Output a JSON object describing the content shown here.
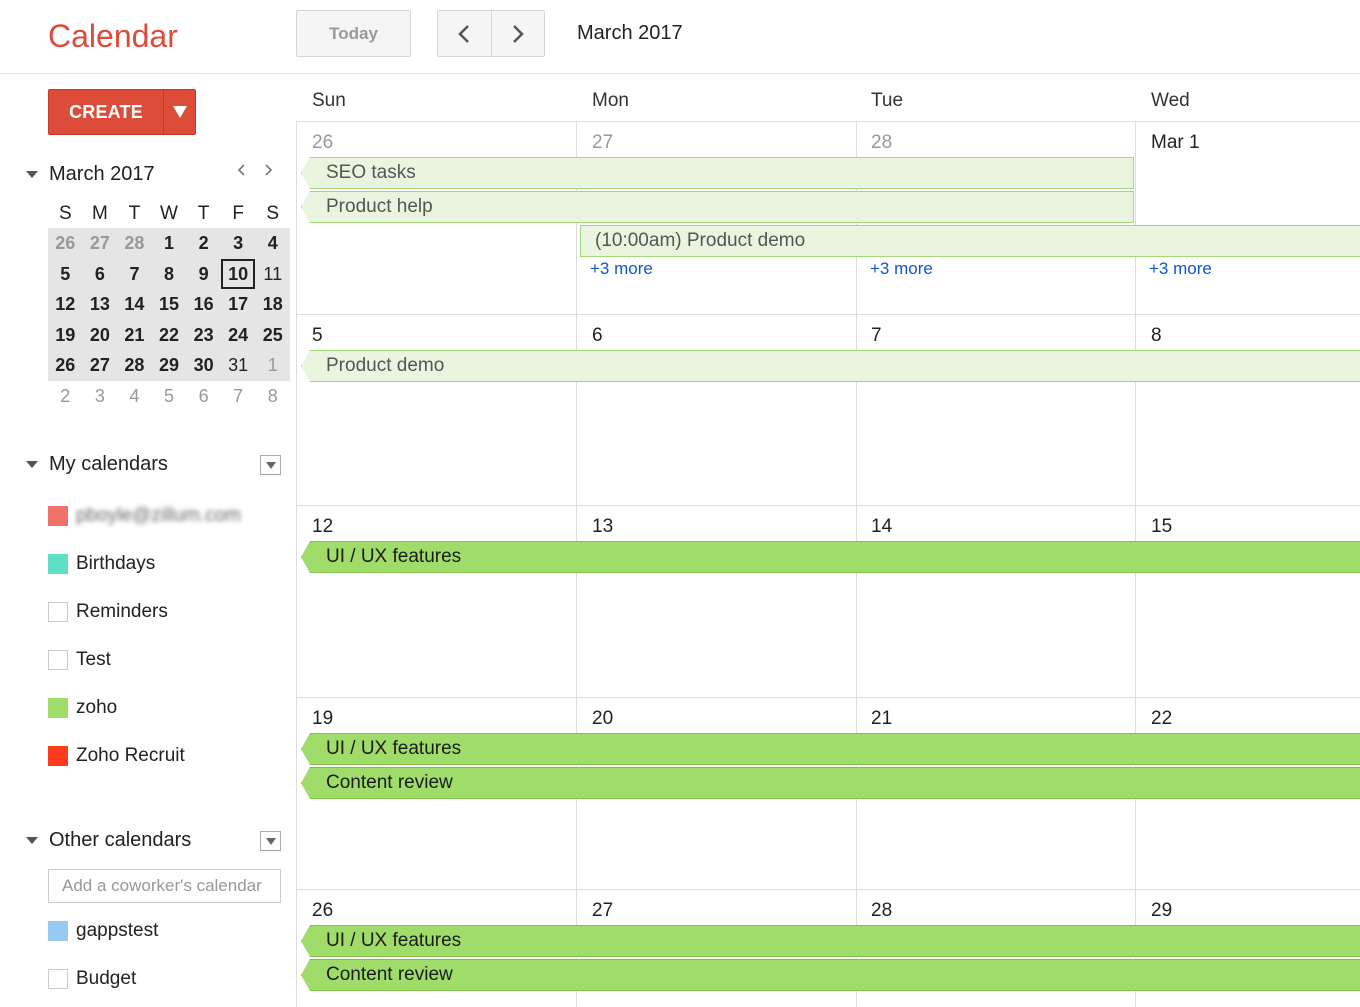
{
  "app": {
    "title": "Calendar"
  },
  "toolbar": {
    "today_label": "Today",
    "current_range": "March 2017"
  },
  "sidebar": {
    "create_label": "CREATE",
    "mini_calendar": {
      "title": "March 2017",
      "weekday_headers": [
        "S",
        "M",
        "T",
        "W",
        "T",
        "F",
        "S"
      ],
      "weeks": [
        [
          "26",
          "27",
          "28",
          "1",
          "2",
          "3",
          "4"
        ],
        [
          "5",
          "6",
          "7",
          "8",
          "9",
          "10",
          "11"
        ],
        [
          "12",
          "13",
          "14",
          "15",
          "16",
          "17",
          "18"
        ],
        [
          "19",
          "20",
          "21",
          "22",
          "23",
          "24",
          "25"
        ],
        [
          "26",
          "27",
          "28",
          "29",
          "30",
          "31",
          "1"
        ],
        [
          "2",
          "3",
          "4",
          "5",
          "6",
          "7",
          "8"
        ]
      ],
      "today": "10"
    },
    "my_calendars": {
      "title": "My calendars",
      "items": [
        {
          "label": "pboyle@zillum.com",
          "color": "#f0706a",
          "checked": true,
          "blurred": true
        },
        {
          "label": "Birthdays",
          "color": "#5fe0c4",
          "checked": true
        },
        {
          "label": "Reminders",
          "color": "",
          "checked": false
        },
        {
          "label": "Test",
          "color": "",
          "checked": false
        },
        {
          "label": "zoho",
          "color": "#a0dc69",
          "checked": true
        },
        {
          "label": "Zoho Recruit",
          "color": "#ff3b1e",
          "checked": true
        }
      ]
    },
    "other_calendars": {
      "title": "Other calendars",
      "add_placeholder": "Add a coworker's calendar",
      "items": [
        {
          "label": "gappstest",
          "color": "#9ac9f0",
          "checked": true
        },
        {
          "label": "Budget",
          "color": "",
          "checked": false
        }
      ]
    }
  },
  "grid": {
    "weekdays": [
      "Sun",
      "Mon",
      "Tue",
      "Wed"
    ],
    "weeks": [
      {
        "days": [
          "26",
          "27",
          "28",
          "Mar 1"
        ],
        "events": [
          {
            "title": "SEO tasks",
            "style": "light"
          },
          {
            "title": "Product help",
            "style": "light"
          },
          {
            "title": "(10:00am) Product demo",
            "style": "light"
          }
        ],
        "more": [
          "+3 more",
          "+3 more",
          "+3 more"
        ]
      },
      {
        "days": [
          "5",
          "6",
          "7",
          "8"
        ],
        "events": [
          {
            "title": "Product demo",
            "style": "light"
          }
        ]
      },
      {
        "days": [
          "12",
          "13",
          "14",
          "15"
        ],
        "events": [
          {
            "title": "UI / UX features",
            "style": "green"
          }
        ]
      },
      {
        "days": [
          "19",
          "20",
          "21",
          "22"
        ],
        "events": [
          {
            "title": "UI / UX features",
            "style": "green"
          },
          {
            "title": "Content review",
            "style": "green"
          }
        ]
      },
      {
        "days": [
          "26",
          "27",
          "28",
          "29"
        ],
        "events": [
          {
            "title": "UI / UX features",
            "style": "green"
          },
          {
            "title": "Content review",
            "style": "green"
          }
        ]
      }
    ]
  }
}
